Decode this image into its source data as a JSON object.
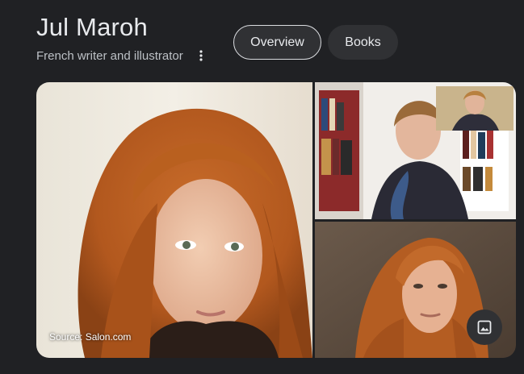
{
  "entity": {
    "name": "Jul Maroh",
    "description": "French writer and illustrator"
  },
  "tabs": [
    {
      "label": "Overview",
      "selected": true
    },
    {
      "label": "Books",
      "selected": false
    }
  ],
  "gallery": {
    "main_image": {
      "description_icon": "portrait-photo",
      "source_caption": "Source: Salon.com"
    },
    "top_right_image": {
      "description_icon": "video-call-photo"
    },
    "bottom_right_image": {
      "description_icon": "portrait-photo"
    },
    "more_images_icon": "image-icon"
  },
  "menu_icon": "more-vert-icon",
  "colors": {
    "background": "#202124",
    "text_primary": "#e8eaed",
    "text_secondary": "#bdc1c6",
    "tab_background": "#303134"
  }
}
